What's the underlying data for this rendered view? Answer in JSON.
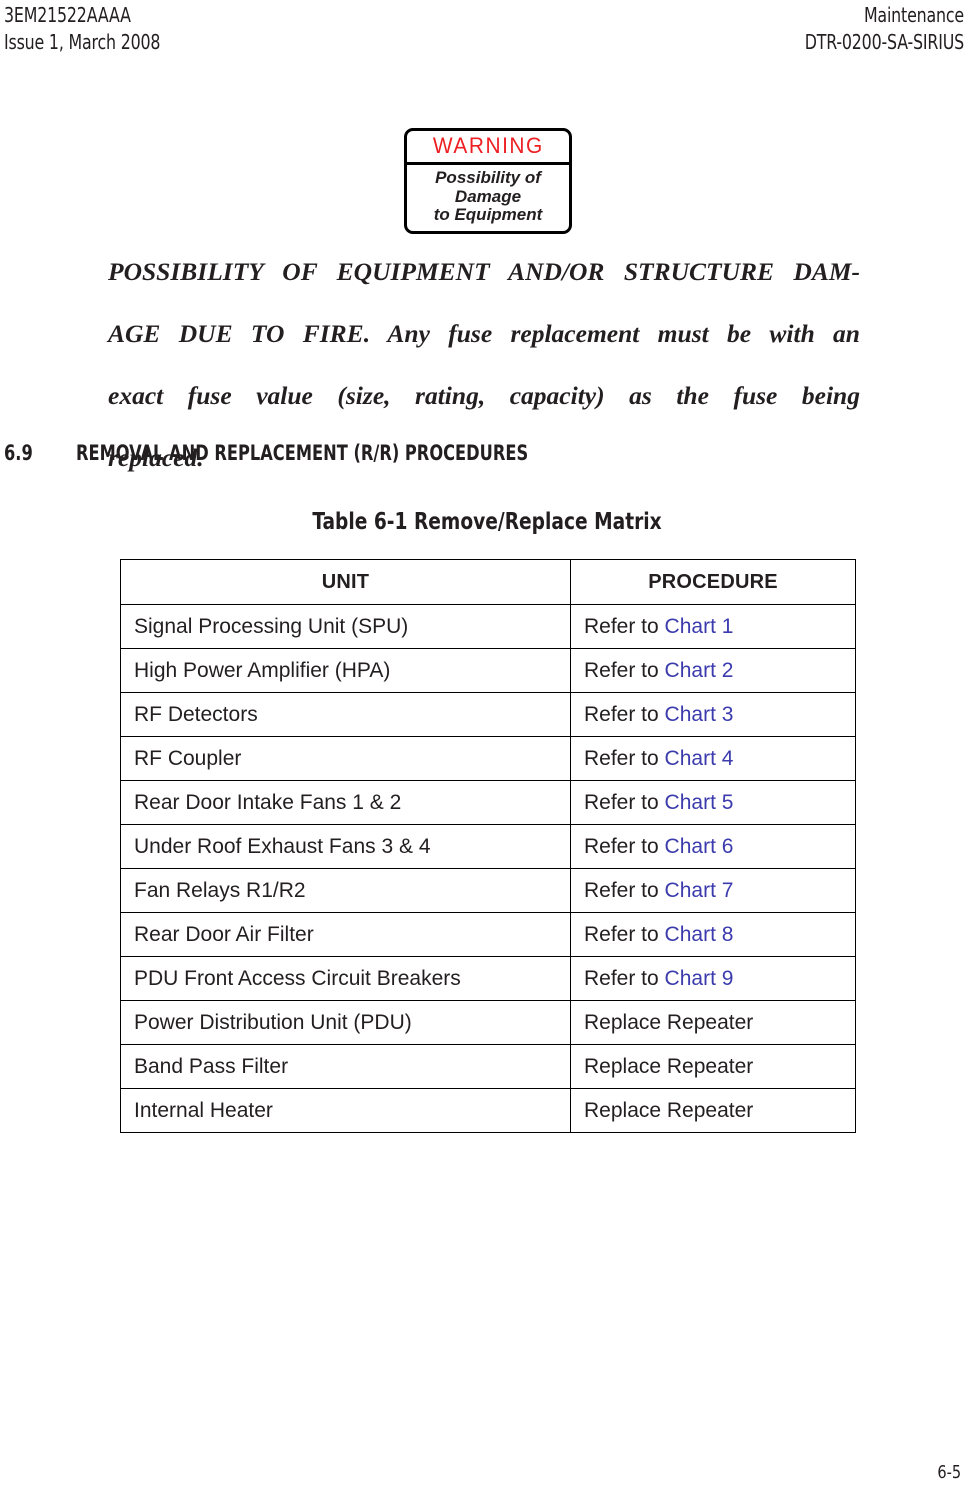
{
  "header": {
    "left_line1": "3EM21522AAAA",
    "left_line2": "Issue 1, March 2008",
    "right_line1": "Maintenance",
    "right_line2": "DTR-0200-SA-SIRIUS"
  },
  "warning_sign": {
    "title": "WARNING",
    "title_color": "#ED2024",
    "body_line1": "Possibility of",
    "body_line2": "Damage",
    "body_line3": "to Equipment"
  },
  "warning_text": {
    "line1": "POSSIBILITY OF EQUIPMENT AND/OR STRUCTURE DAM-",
    "line2": "AGE DUE TO FIRE. Any fuse replacement must be with an",
    "line3": "exact fuse value (size, rating, capacity) as the fuse being",
    "line4": "replaced."
  },
  "section": {
    "number": "6.9",
    "title": "REMOVAL AND REPLACEMENT (R/R) PROCEDURES"
  },
  "table": {
    "caption": "Table 6-1  Remove/Replace Matrix",
    "link_color": "#3B3BAE",
    "headers": [
      "UNIT",
      "PROCEDURE"
    ],
    "rows": [
      {
        "unit": "Signal Processing Unit (SPU)",
        "procedure_prefix": "Refer to ",
        "procedure_link": "Chart 1"
      },
      {
        "unit": "High Power Amplifier (HPA)",
        "procedure_prefix": "Refer to ",
        "procedure_link": "Chart 2"
      },
      {
        "unit": "RF Detectors",
        "procedure_prefix": "Refer to ",
        "procedure_link": "Chart 3"
      },
      {
        "unit": "RF Coupler",
        "procedure_prefix": "Refer to ",
        "procedure_link": "Chart 4"
      },
      {
        "unit": "Rear Door Intake Fans 1 & 2",
        "procedure_prefix": "Refer to ",
        "procedure_link": "Chart 5"
      },
      {
        "unit": "Under Roof Exhaust Fans 3 & 4",
        "procedure_prefix": "Refer to ",
        "procedure_link": "Chart 6"
      },
      {
        "unit": "Fan Relays R1/R2",
        "procedure_prefix": "Refer to ",
        "procedure_link": "Chart 7"
      },
      {
        "unit": "Rear Door Air Filter",
        "procedure_prefix": "Refer to ",
        "procedure_link": "Chart 8"
      },
      {
        "unit": "PDU Front Access Circuit Breakers",
        "procedure_prefix": "Refer to ",
        "procedure_link": "Chart 9"
      },
      {
        "unit": "Power Distribution Unit (PDU)",
        "procedure_prefix": "Replace Repeater",
        "procedure_link": ""
      },
      {
        "unit": "Band Pass Filter",
        "procedure_prefix": "Replace Repeater",
        "procedure_link": ""
      },
      {
        "unit": "Internal Heater",
        "procedure_prefix": "Replace Repeater",
        "procedure_link": ""
      }
    ]
  },
  "footer": {
    "page_number": "6-5"
  }
}
